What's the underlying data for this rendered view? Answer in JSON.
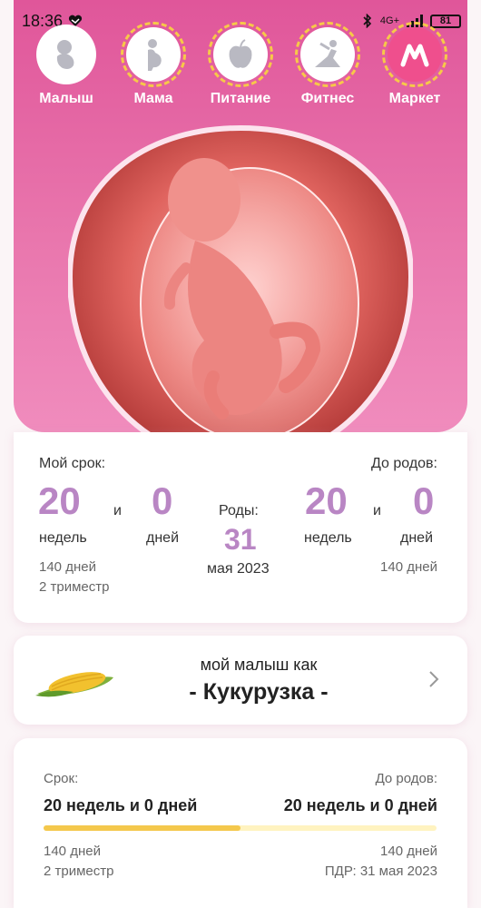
{
  "status": {
    "time": "18:36",
    "network": "4G+",
    "battery": "81"
  },
  "nav": [
    {
      "label": "Малыш",
      "icon": "baby-icon"
    },
    {
      "label": "Мама",
      "icon": "pregnant-mother-icon"
    },
    {
      "label": "Питание",
      "icon": "apple-icon"
    },
    {
      "label": "Фитнес",
      "icon": "yoga-icon"
    },
    {
      "label": "Маркет",
      "icon": "market-logo-icon"
    }
  ],
  "term": {
    "my_term_label": "Мой срок:",
    "until_birth_label": "До родов:",
    "weeks_value": "20",
    "days_value": "0",
    "and": "и",
    "weeks_unit": "недель",
    "days_unit": "дней",
    "birth_label": "Роды:",
    "birth_day": "31",
    "birth_month_year": "мая 2023",
    "remaining_weeks": "20",
    "remaining_days": "0",
    "total_days_left": "140 дней",
    "trimester": "2 триместр",
    "total_days_right": "140 дней"
  },
  "baby": {
    "caption": "мой малыш как",
    "fruit": "- Кукурузка -",
    "icon": "corn-icon"
  },
  "progress": {
    "term_label": "Срок:",
    "until_label": "До родов:",
    "term_value": "20 недель и 0 дней",
    "until_value": "20 недель и 0 дней",
    "fraction": 0.5,
    "days_left": "140 дней",
    "trimester": "2 триместр",
    "days_right": "140 дней",
    "due_date": "ПДР: 31 мая 2023"
  },
  "colors": {
    "pink": "#e0569a",
    "purple_number": "#b986c4",
    "progress_fill": "#f4c84c",
    "progress_bg": "#fff3c0"
  }
}
